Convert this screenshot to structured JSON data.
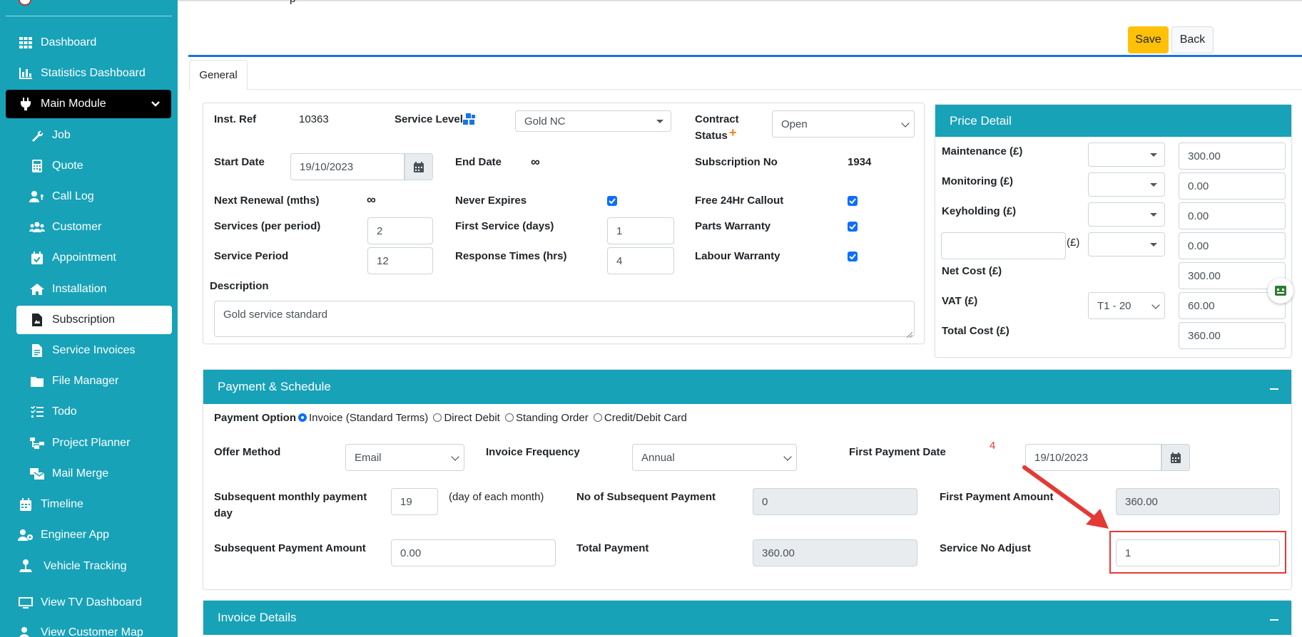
{
  "sidebar": {
    "items": [
      {
        "label": "Dashboard",
        "icon": "grid-icon"
      },
      {
        "label": "Statistics Dashboard",
        "icon": "bar-chart-icon"
      },
      {
        "label": "Main Module",
        "icon": "plug-icon"
      },
      {
        "label": "Job",
        "icon": "wrench-icon"
      },
      {
        "label": "Quote",
        "icon": "calculator-icon"
      },
      {
        "label": "Call Log",
        "icon": "user-phone-icon"
      },
      {
        "label": "Customer",
        "icon": "users-icon"
      },
      {
        "label": "Appointment",
        "icon": "calendar-check-icon"
      },
      {
        "label": "Installation",
        "icon": "home-icon"
      },
      {
        "label": "Subscription",
        "icon": "document-icon"
      },
      {
        "label": "Service Invoices",
        "icon": "invoice-icon"
      },
      {
        "label": "File Manager",
        "icon": "folder-icon"
      },
      {
        "label": "Todo",
        "icon": "checklist-icon"
      },
      {
        "label": "Project Planner",
        "icon": "sitemap-icon"
      },
      {
        "label": "Mail Merge",
        "icon": "mail-merge-icon"
      },
      {
        "label": "Timeline",
        "icon": "calendar-icon"
      },
      {
        "label": "Engineer App",
        "icon": "user-gear-icon"
      },
      {
        "label": "Vehicle Tracking",
        "icon": "vehicle-tracking-icon"
      },
      {
        "label": "View TV Dashboard",
        "icon": "monitor-icon"
      },
      {
        "label": "View Customer Map",
        "icon": "map-user-icon"
      }
    ]
  },
  "header": {
    "partial_title": "p",
    "save_label": "Save",
    "back_label": "Back"
  },
  "tabs": {
    "general": "General"
  },
  "general": {
    "inst_ref_label": "Inst. Ref",
    "inst_ref_value": "10363",
    "service_level_label": "Service Level",
    "service_level_value": "Gold NC",
    "contract_status_label_1": "Contract",
    "contract_status_label_2": "Status",
    "contract_status_value": "Open",
    "start_date_label": "Start Date",
    "start_date_value": "19/10/2023",
    "end_date_label": "End Date",
    "end_date_value": "∞",
    "subscription_no_label": "Subscription No",
    "subscription_no_value": "1934",
    "next_renewal_label": "Next Renewal (mths)",
    "next_renewal_value": "∞",
    "never_expires_label": "Never Expires",
    "free_callout_label": "Free 24Hr Callout",
    "services_label": "Services (per period)",
    "services_value": "2",
    "first_service_label": "First Service (days)",
    "first_service_value": "1",
    "parts_warranty_label": "Parts Warranty",
    "service_period_label": "Service Period",
    "service_period_value": "12",
    "response_times_label": "Response Times (hrs)",
    "response_times_value": "4",
    "labour_warranty_label": "Labour Warranty",
    "description_label": "Description",
    "description_value": "Gold service standard"
  },
  "price": {
    "title": "Price Detail",
    "maintenance_label": "Maintenance (£)",
    "maintenance_value": "300.00",
    "monitoring_label": "Monitoring (£)",
    "monitoring_value": "0.00",
    "keyholding_label": "Keyholding (£)",
    "keyholding_value": "0.00",
    "custom_unit": "(£)",
    "custom_value": "0.00",
    "net_cost_label": "Net Cost (£)",
    "net_cost_value": "300.00",
    "vat_label": "VAT (£)",
    "vat_code": "T1 - 20",
    "vat_value": "60.00",
    "total_cost_label": "Total Cost (£)",
    "total_cost_value": "360.00"
  },
  "payment": {
    "title": "Payment & Schedule",
    "payment_option_label": "Payment Option",
    "options": [
      "Invoice (Standard Terms)",
      "Direct Debit",
      "Standing Order",
      "Credit/Debit Card"
    ],
    "offer_method_label": "Offer Method",
    "offer_method_value": "Email",
    "invoice_frequency_label": "Invoice Frequency",
    "invoice_frequency_value": "Annual",
    "first_payment_date_label": "First Payment Date",
    "first_payment_date_value": "19/10/2023",
    "annotation_number": "4",
    "subsequent_day_label_1": "Subsequent monthly payment",
    "subsequent_day_label_2": "day",
    "subsequent_day_value": "19",
    "subsequent_day_hint": "(day of each month)",
    "no_subsequent_label": "No of Subsequent Payment",
    "no_subsequent_value": "0",
    "first_amount_label": "First Payment Amount",
    "first_amount_value": "360.00",
    "subsequent_amount_label": "Subsequent Payment Amount",
    "subsequent_amount_value": "0.00",
    "total_payment_label": "Total Payment",
    "total_payment_value": "360.00",
    "service_no_adjust_label": "Service No Adjust",
    "service_no_adjust_value": "1"
  },
  "invoice_details": {
    "title": "Invoice Details"
  },
  "colors": {
    "sidebar": "#17a2b8",
    "save": "#ffc107",
    "checkbox": "#0d6efd",
    "highlight": "#e53935"
  }
}
